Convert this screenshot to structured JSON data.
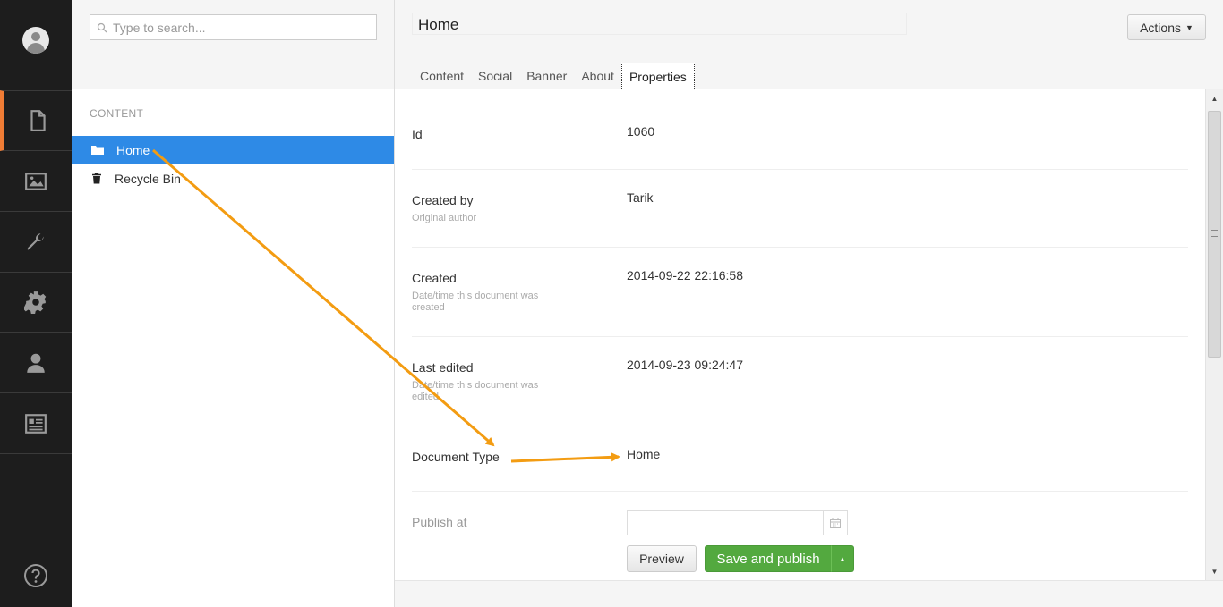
{
  "colors": {
    "rail_bg": "#1d1d1d",
    "rail_active_accent": "#f07c35",
    "selected_node": "#2e8ae6",
    "save_button": "#53a93f",
    "annotation_arrow": "#f39c12"
  },
  "rail": {
    "items": [
      {
        "icon": "document-icon",
        "active": true
      },
      {
        "icon": "image-icon"
      },
      {
        "icon": "wrench-icon"
      },
      {
        "icon": "gear-icon"
      },
      {
        "icon": "user-icon"
      },
      {
        "icon": "id-card-icon"
      }
    ],
    "help_icon": "help-icon"
  },
  "tree": {
    "search_placeholder": "Type to search...",
    "section_title": "CONTENT",
    "nodes": [
      {
        "label": "Home",
        "icon": "folder-icon",
        "selected": true
      },
      {
        "label": "Recycle Bin",
        "icon": "trash-icon"
      }
    ]
  },
  "editor": {
    "name": "Home",
    "actions_label": "Actions",
    "tabs": [
      "Content",
      "Social",
      "Banner",
      "About",
      "Properties"
    ],
    "active_tab": "Properties",
    "properties": [
      {
        "label": "Id",
        "description": "",
        "value": "1060"
      },
      {
        "label": "Created by",
        "description": "Original author",
        "value": "Tarik"
      },
      {
        "label": "Created",
        "description": "Date/time this document was created",
        "value": "2014-09-22 22:16:58"
      },
      {
        "label": "Last edited",
        "description": "Date/time this document was edited",
        "value": "2014-09-23 09:24:47"
      },
      {
        "label": "Document Type",
        "description": "",
        "value": "Home"
      },
      {
        "label": "Publish at",
        "description": "",
        "value": ""
      }
    ],
    "buttons": {
      "preview": "Preview",
      "save_publish": "Save and publish"
    }
  }
}
